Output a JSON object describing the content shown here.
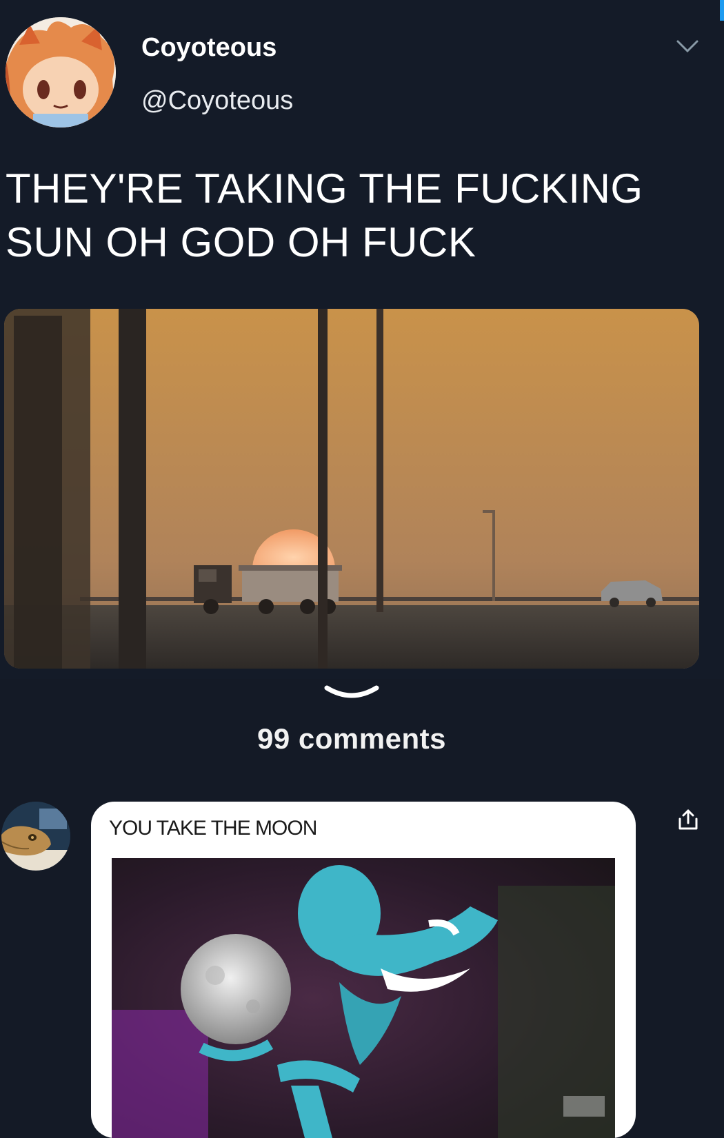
{
  "tweet": {
    "author": {
      "display_name": "Coyoteous",
      "handle": "@Coyoteous",
      "avatar_icon": "fox-character-avatar"
    },
    "text_line1": "THEY'RE TAKING THE FUCKING",
    "text_line2": "SUN OH GOD OH FUCK",
    "menu_icon": "chevron-down-icon",
    "image": {
      "subject": "sunset-behind-truck-photo"
    }
  },
  "comments": {
    "expand_icon": "chevron-down-icon",
    "count_label": "99 comments",
    "items": [
      {
        "avatar_icon": "lizard-avatar",
        "caption": "YOU TAKE THE MOON",
        "share_icon": "share-icon"
      }
    ]
  },
  "colors": {
    "background": "#141b28",
    "accent": "#1d9bf0",
    "sun": "#ffb98a"
  }
}
